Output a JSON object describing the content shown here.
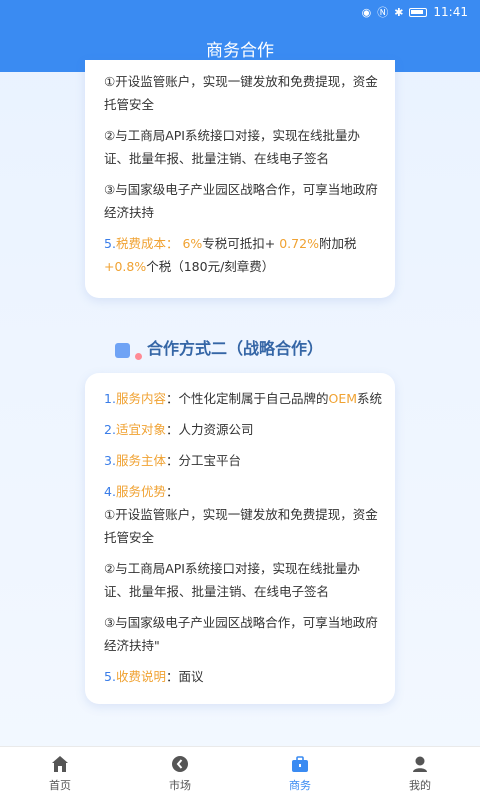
{
  "status": {
    "time": "11:41"
  },
  "title": "商务合作",
  "card1": {
    "lines": [
      "①开设监管账户，实现一键发放和免费提现，资金",
      "托管安全",
      "②与工商局API系统接口对接，实现在线批量办",
      "证、批量年报、批量注销、在线电子签名",
      "③与国家级电子产业园区战略合作，可享当地政府",
      "经济扶持"
    ],
    "fee": {
      "prefix": "5.",
      "label": "税费成本：",
      "a": "6%",
      "b": "专税可抵扣+ ",
      "c": "0.72%",
      "d": "附加税",
      "e": "+0.8%",
      "f": "个税（180元/刻章费）"
    }
  },
  "section2": {
    "title": "合作方式二（战略合作）"
  },
  "card2": {
    "item1": {
      "prefix": "1.",
      "label": "服务内容",
      "colon": "：",
      "value": "个性化定制属于自己品牌的",
      "oem": "OEM",
      "tail": "系统"
    },
    "item2": {
      "prefix": "2.",
      "label": "适宜对象",
      "colon": "：",
      "value": "人力资源公司"
    },
    "item3": {
      "prefix": "3.",
      "label": "服务主体",
      "colon": "：",
      "value": "分工宝平台"
    },
    "item4": {
      "prefix": "4.",
      "label": "服务优势",
      "colon": "："
    },
    "lines": [
      "①开设监管账户，实现一键发放和免费提现，资金",
      "托管安全",
      "②与工商局API系统接口对接，实现在线批量办",
      "证、批量年报、批量注销、在线电子签名",
      "③与国家级电子产业园区战略合作，可享当地政府",
      "经济扶持\""
    ],
    "item5": {
      "prefix": "5.",
      "label": "收费说明",
      "colon": "：",
      "value": "面议"
    }
  },
  "tabs": [
    {
      "label": "首页",
      "icon": "home-icon"
    },
    {
      "label": "市场",
      "icon": "market-icon"
    },
    {
      "label": "商务",
      "icon": "business-icon"
    },
    {
      "label": "我的",
      "icon": "profile-icon"
    }
  ],
  "colors": {
    "primary": "#3a8bf2",
    "label_blue": "#3a7de8",
    "highlight_orange": "#f0a232"
  }
}
